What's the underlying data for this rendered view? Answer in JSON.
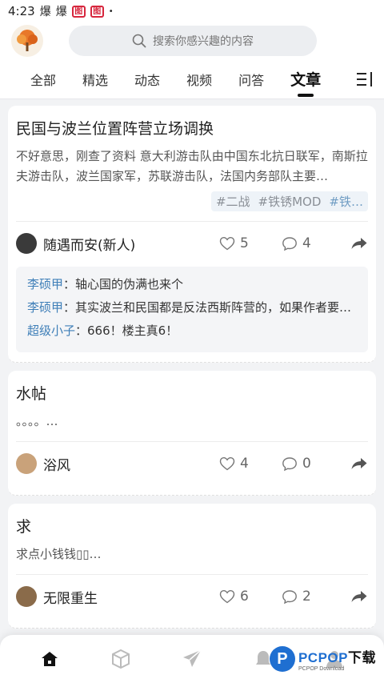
{
  "status_bar": {
    "time": "4:23",
    "icon1": "爆",
    "icon2": "爆",
    "badge1": "图",
    "badge2": "图",
    "dot": "•"
  },
  "search": {
    "placeholder": "搜索你感兴趣的内容"
  },
  "tabs": [
    {
      "label": "全部"
    },
    {
      "label": "精选"
    },
    {
      "label": "动态"
    },
    {
      "label": "视频"
    },
    {
      "label": "问答"
    },
    {
      "label": "文章",
      "active": true
    }
  ],
  "posts": [
    {
      "title": "民国与波兰位置阵营立场调换",
      "excerpt": "不好意思，刚查了资料 意大利游击队由中国东北抗日联军，南斯拉夫游击队，波兰国家军，苏联游击队，法国内务部队主要…",
      "tags": [
        "#二战",
        "#铁锈MOD",
        "#铁…"
      ],
      "author": "随遇而安(新人)",
      "likes": "5",
      "comments": "4",
      "comment_list": [
        {
          "name": "李硕甲",
          "text": "：轴心国的伪满也来个"
        },
        {
          "name": "李硕甲",
          "text": "：其实波兰和民国都是反法西斯阵营的，如果作者要是想给法西斯凑数的话，就把弗朗哥西班牙加…"
        },
        {
          "name": "超级小子",
          "text": "：666！楼主真6！"
        }
      ]
    },
    {
      "title": "水帖",
      "excerpt": "。。。。…",
      "author": "浴风",
      "likes": "4",
      "comments": "0"
    },
    {
      "title": "求",
      "excerpt": "求点小钱钱▯▯…",
      "author": "无限重生",
      "likes": "6",
      "comments": "2"
    }
  ],
  "watermark": {
    "main": "PCPOP",
    "main2": "下载",
    "sub": "PCPOP Download"
  },
  "colors": {
    "accent": "#3f7fb8",
    "brand": "#1f6fd1",
    "background": "#f2f3f5"
  }
}
